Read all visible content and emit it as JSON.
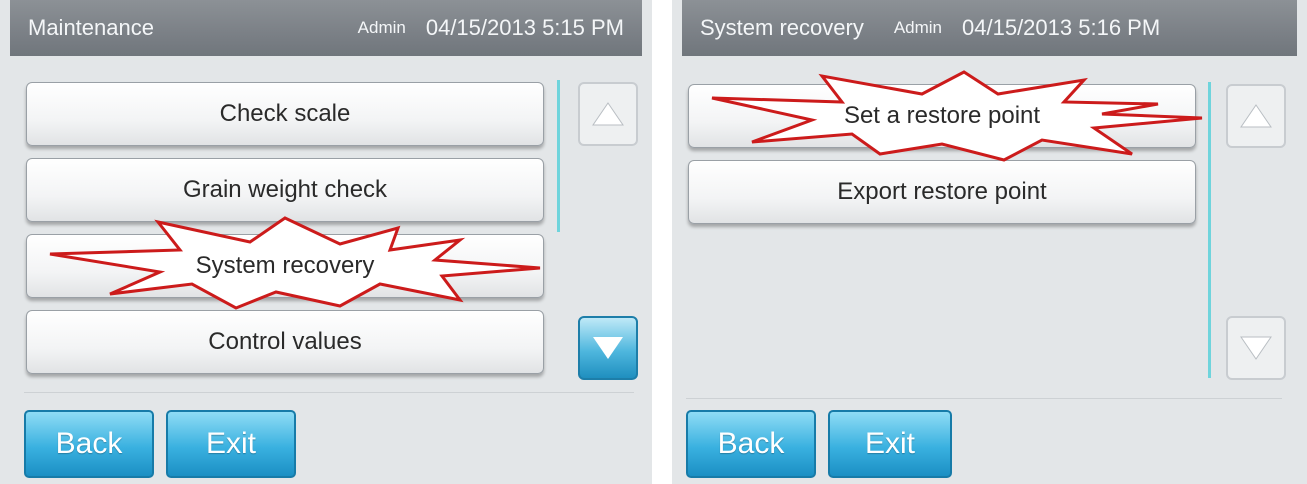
{
  "left_screen": {
    "title": "Maintenance",
    "user": "Admin",
    "datetime": "04/15/2013 5:15 PM",
    "menu": [
      {
        "label": "Check scale"
      },
      {
        "label": "Grain weight check"
      },
      {
        "label": "System recovery"
      },
      {
        "label": "Control values"
      }
    ],
    "scroll_up": {
      "icon": "triangle-up-icon",
      "state": "disabled"
    },
    "scroll_down": {
      "icon": "triangle-down-icon",
      "state": "active"
    },
    "back_label": "Back",
    "exit_label": "Exit"
  },
  "right_screen": {
    "title": "System recovery",
    "user": "Admin",
    "datetime": "04/15/2013 5:16 PM",
    "menu": [
      {
        "label": "Set a restore point"
      },
      {
        "label": "Export restore point"
      }
    ],
    "scroll_up": {
      "icon": "triangle-up-icon",
      "state": "disabled"
    },
    "scroll_down": {
      "icon": "triangle-down-icon",
      "state": "disabled"
    },
    "back_label": "Back",
    "exit_label": "Exit"
  },
  "colors": {
    "titlebar": "#7b8086",
    "background": "#e3e6e8",
    "accent_blue": "#3ab1e0",
    "scroll_track": "#6fd4dc",
    "highlight_burst": "#cc1b1b"
  }
}
